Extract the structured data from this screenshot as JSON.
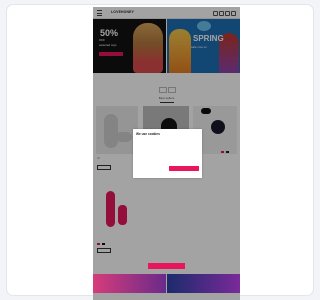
{
  "colors": {
    "accent": "#e8175d",
    "background": "#f3f4f8",
    "banner_left": "#121212",
    "banner_right": "#1e6fb5"
  },
  "header": {
    "logo": "LOVEHONEY",
    "icons": [
      "menu-icon",
      "search-icon",
      "account-icon",
      "wishlist-icon",
      "basket-icon"
    ]
  },
  "banners": [
    {
      "headline": "50%",
      "subline": "OFF",
      "caption": "selected toys"
    },
    {
      "headline": "SPRING",
      "caption": "sale now on"
    }
  ],
  "products": {
    "heading": "Best sellers"
  },
  "cookie_modal": {
    "title": "We use cookies",
    "body": "",
    "cancel_label": "",
    "accept_label": ""
  }
}
